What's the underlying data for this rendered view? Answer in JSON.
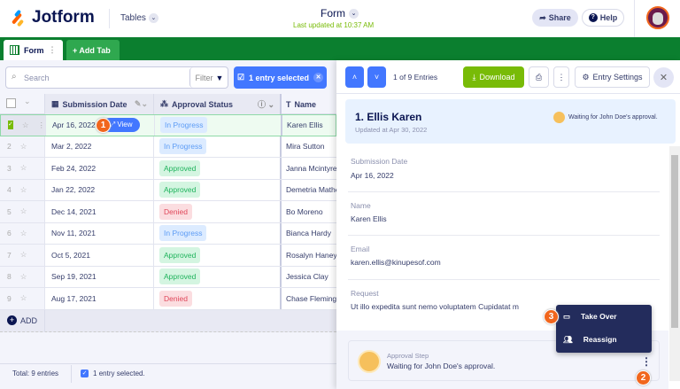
{
  "header": {
    "logo": "Jotform",
    "tables_label": "Tables",
    "form_title": "Form",
    "last_updated": "Last updated at 10:37 AM",
    "share": "Share",
    "help": "Help"
  },
  "tabs": {
    "form": "Form",
    "add_tab": "+ Add Tab"
  },
  "toolbar": {
    "search_placeholder": "Search",
    "filter": "Filter",
    "selected": "1 entry selected"
  },
  "table": {
    "columns": [
      "Submission Date",
      "Approval Status",
      "Name"
    ],
    "rows": [
      {
        "n": "1",
        "date": "Apr 16, 2022",
        "status": "In Progress",
        "name": "Karen Ellis"
      },
      {
        "n": "2",
        "date": "Mar 2, 2022",
        "status": "In Progress",
        "name": "Mira Sutton"
      },
      {
        "n": "3",
        "date": "Feb 24, 2022",
        "status": "Approved",
        "name": "Janna Mcintyre"
      },
      {
        "n": "4",
        "date": "Jan 22, 2022",
        "status": "Approved",
        "name": "Demetria Mathe"
      },
      {
        "n": "5",
        "date": "Dec 14, 2021",
        "status": "Denied",
        "name": "Bo Moreno"
      },
      {
        "n": "6",
        "date": "Nov 11, 2021",
        "status": "In Progress",
        "name": "Bianca Hardy"
      },
      {
        "n": "7",
        "date": "Oct 5, 2021",
        "status": "Approved",
        "name": "Rosalyn Haney"
      },
      {
        "n": "8",
        "date": "Sep 19, 2021",
        "status": "Approved",
        "name": "Jessica Clay"
      },
      {
        "n": "9",
        "date": "Aug 17, 2021",
        "status": "Denied",
        "name": "Chase Fleming"
      }
    ],
    "view": "View",
    "add": "ADD"
  },
  "footer": {
    "total": "Total: 9 entries",
    "selected": "1 entry selected."
  },
  "panel": {
    "counter": "1 of 9 Entries",
    "download": "Download",
    "entry_settings": "Entry Settings",
    "title": "1. Ellis Karen",
    "updated": "Updated at Apr 30, 2022",
    "waiting": "Waiting for John Doe's approval.",
    "fields": [
      {
        "label": "Submission Date",
        "value": "Apr 16, 2022"
      },
      {
        "label": "Name",
        "value": "Karen Ellis"
      },
      {
        "label": "Email",
        "value": "karen.ellis@kinupesof.com"
      },
      {
        "label": "Request",
        "value": "Ut illo expedita sunt nemo voluptatem Cupidatat m"
      }
    ],
    "approval_step": "Approval Step",
    "approval_waiting": "Waiting for John Doe's approval.",
    "menu": [
      "Take Over",
      "Reassign"
    ]
  },
  "markers": [
    "1",
    "2",
    "3"
  ]
}
